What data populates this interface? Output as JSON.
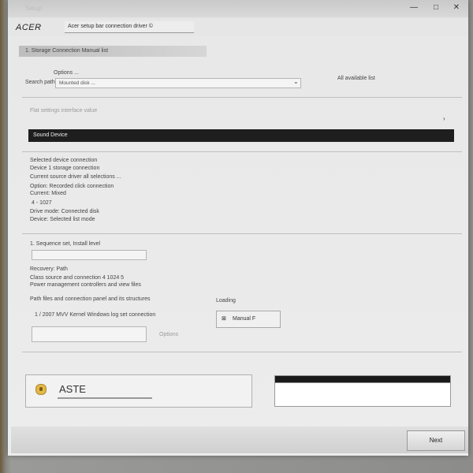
{
  "window": {
    "title": "Setup",
    "controls": {
      "minimize": "—",
      "maximize": "□",
      "close": "✕"
    }
  },
  "topbar": {
    "logo": "ACER",
    "address": "Acer setup bar connection driver ©"
  },
  "breadcrumb": "1. Storage Connection Manual list",
  "section1": {
    "label": "Search path",
    "header_hint": "Options ...",
    "input_value": "Mounted disk ...",
    "right_label": "All available list"
  },
  "section2": {
    "faint_label": "Flat settings interface value",
    "chevron": "›",
    "black_bar": "Sound Device"
  },
  "section3": {
    "lines": [
      "Selected device connection",
      "Device 1 storage connection",
      "Current source driver all selections ...",
      "Option: Recorded click connection",
      "Current: Mixed",
      "4 - 1027",
      "Drive mode: Connected disk",
      "Device: Selected list mode"
    ]
  },
  "section4": {
    "label": "1. Sequence set, Install level",
    "field_value": "",
    "lines": [
      "Recovery: Path",
      "Class source and connection 4 1024 5",
      "Power management controllers and view files"
    ],
    "long_line": "Path files and connection panel and its structures",
    "checkbox_caption": "Loading",
    "checkbox_label": "Manual F",
    "option_line": "1 / 2007 MVV Kernel Windows log set connection",
    "bottom_field": "",
    "bottom_field_right": "Options"
  },
  "bottom": {
    "brand": "ASTE"
  },
  "footer": {
    "next_label": "Next"
  }
}
